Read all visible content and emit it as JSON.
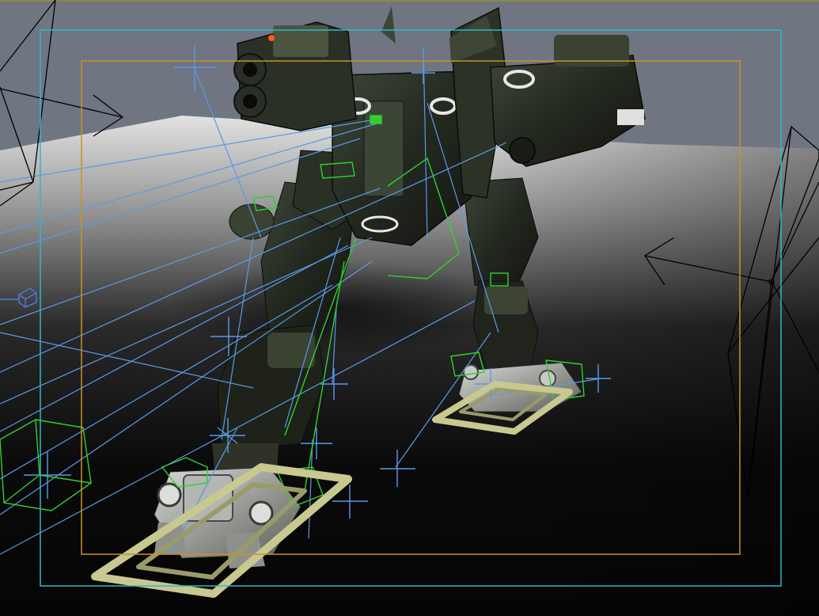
{
  "viewport": {
    "mode": "3d-perspective-view",
    "colors": {
      "sky": "#6f7581",
      "top_edge": "#8a8a4a",
      "floor_light": "#dcdcdc",
      "floor_dark": "#050505",
      "safe_frame_outer": "#2fb8c8",
      "safe_frame_inner": "#c8922a",
      "bone": "#5a9ae8",
      "ik_handle": "#30d030",
      "light_gizmo": "#000000",
      "foot_control": "#c8c890",
      "mech_armor": "#2a3026",
      "mech_camo": "#4a5440",
      "mech_metal": "#a8aaa6"
    },
    "gizmos": {
      "left_camera": "camera-icon",
      "right_camera": "camera-icon",
      "light_arrow_left": "directional-light-arrow",
      "light_arrow_right": "directional-light-arrow",
      "locator_cube": "locator-icon"
    }
  }
}
